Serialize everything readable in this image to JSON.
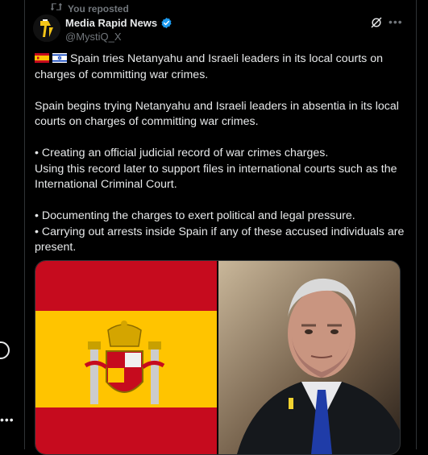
{
  "repost": {
    "label": "You reposted"
  },
  "author": {
    "name": "Media Rapid News",
    "handle": "@MystiQ_X"
  },
  "tweet": {
    "headline": "Spain tries Netanyahu and Israeli leaders in its local courts on charges of committing war crimes.",
    "paragraph2": "Spain begins trying Netanyahu and Israeli leaders in absentia in its local courts on charges of committing war crimes.",
    "bullet1_line1": "• Creating an official judicial record of war crimes charges.",
    "bullet1_line2": "Using this record later to support files in international courts such as the International Criminal Court.",
    "bullet2": "• Documenting the charges to exert political and legal pressure.",
    "bullet3": "• Carrying out arrests inside Spain if any of these accused individuals are present."
  },
  "icons": {
    "repost": "repost-icon",
    "verified": "verified-badge-icon",
    "grok": "grok-icon",
    "more": "more-icon",
    "flag_spain": "spain-flag-icon",
    "flag_israel": "israel-flag-icon"
  },
  "colors": {
    "background": "#000000",
    "text": "#e7e9ea",
    "muted": "#71767b",
    "verified": "#1d9bf0",
    "spain_red": "#c60b1e",
    "spain_yellow": "#ffc400"
  }
}
